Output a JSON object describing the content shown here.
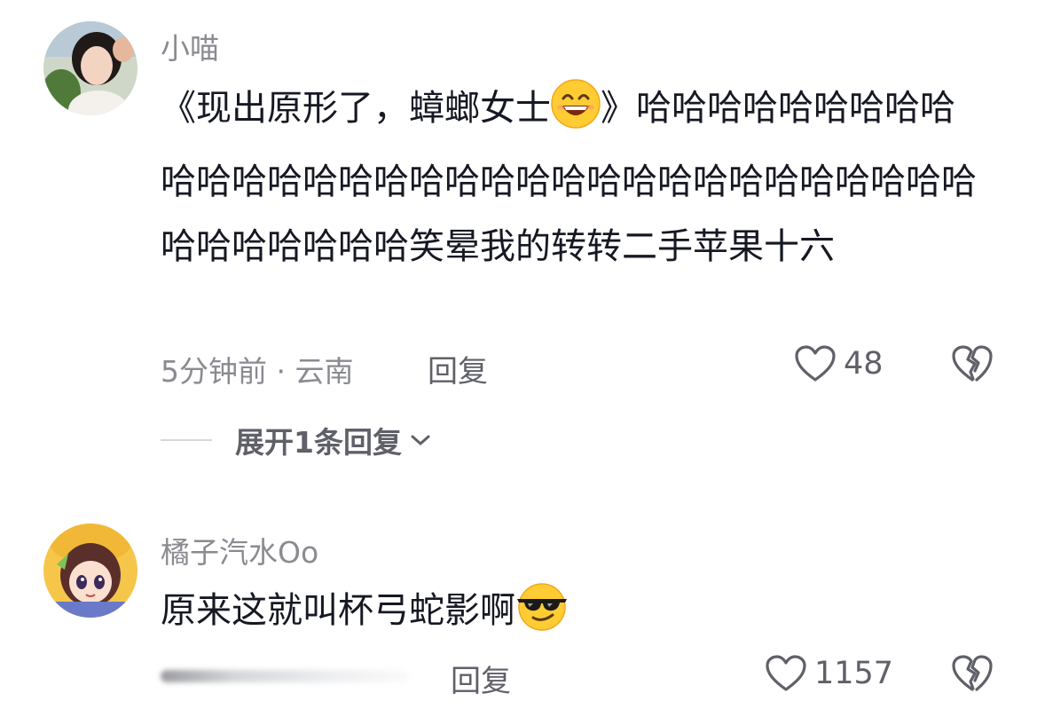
{
  "comments": [
    {
      "username": "小喵",
      "text_before_emoji": "《现出原形了，蟑螂女士",
      "emoji": "grinning-face-with-smiling-eyes",
      "text_after_emoji": "》哈哈哈哈哈哈哈哈哈哈哈哈哈哈哈哈哈哈哈哈哈哈哈哈哈哈哈哈哈哈哈哈哈哈哈哈哈哈哈笑晕我的转转二手苹果十六",
      "meta": "5分钟前 · 云南",
      "reply_label": "回复",
      "like_count": "48",
      "expand_label": "展开1条回复"
    },
    {
      "username": "橘子汽水Oo",
      "text": "原来这就叫杯弓蛇影啊",
      "emoji": "smiling-face-with-sunglasses",
      "reply_label": "回复",
      "like_count": "1157"
    }
  ],
  "colors": {
    "username": "#8a8b91",
    "body_text": "#161823",
    "action_gray": "#5f6068"
  }
}
